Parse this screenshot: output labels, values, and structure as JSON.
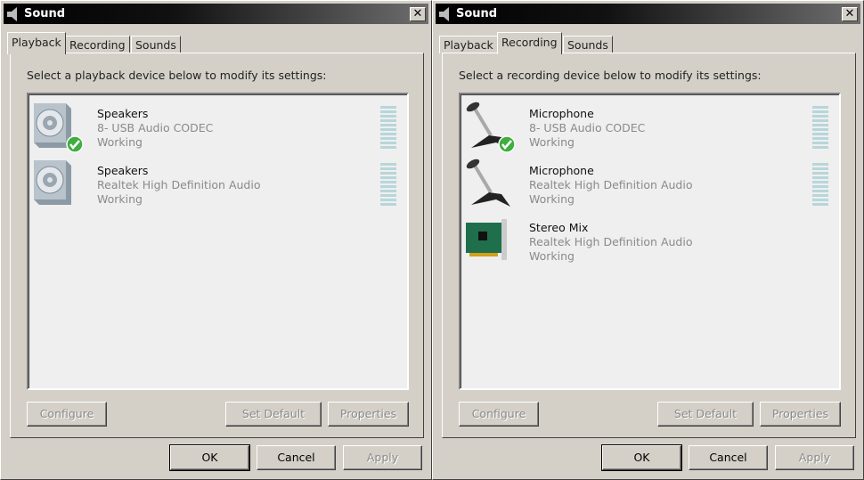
{
  "windows": [
    {
      "title": "Sound",
      "close": "✕",
      "tabs": [
        "Playback",
        "Recording",
        "Sounds"
      ],
      "active_tab": 0,
      "instruction": "Select a playback device below to modify its settings:",
      "devices": [
        {
          "icon": "speaker-icon",
          "name": "Speakers",
          "desc": "8- USB Audio CODEC",
          "status": "Working",
          "default": true
        },
        {
          "icon": "speaker-icon",
          "name": "Speakers",
          "desc": "Realtek High Definition Audio",
          "status": "Working",
          "default": false
        }
      ],
      "buttons": {
        "configure": "Configure",
        "set_default": "Set Default",
        "properties": "Properties"
      },
      "dialog": {
        "ok": "OK",
        "cancel": "Cancel",
        "apply": "Apply"
      }
    },
    {
      "title": "Sound",
      "close": "✕",
      "tabs": [
        "Playback",
        "Recording",
        "Sounds"
      ],
      "active_tab": 1,
      "instruction": "Select a recording device below to modify its settings:",
      "devices": [
        {
          "icon": "microphone-icon",
          "name": "Microphone",
          "desc": "8- USB Audio CODEC",
          "status": "Working",
          "default": true,
          "meter": true
        },
        {
          "icon": "microphone-icon",
          "name": "Microphone",
          "desc": "Realtek High Definition Audio",
          "status": "Working",
          "default": false,
          "meter": true
        },
        {
          "icon": "sound-card-icon",
          "name": "Stereo Mix",
          "desc": "Realtek High Definition Audio",
          "status": "Working",
          "default": false,
          "meter": false
        }
      ],
      "buttons": {
        "configure": "Configure",
        "set_default": "Set Default",
        "properties": "Properties"
      },
      "dialog": {
        "ok": "OK",
        "cancel": "Cancel",
        "apply": "Apply"
      }
    }
  ]
}
